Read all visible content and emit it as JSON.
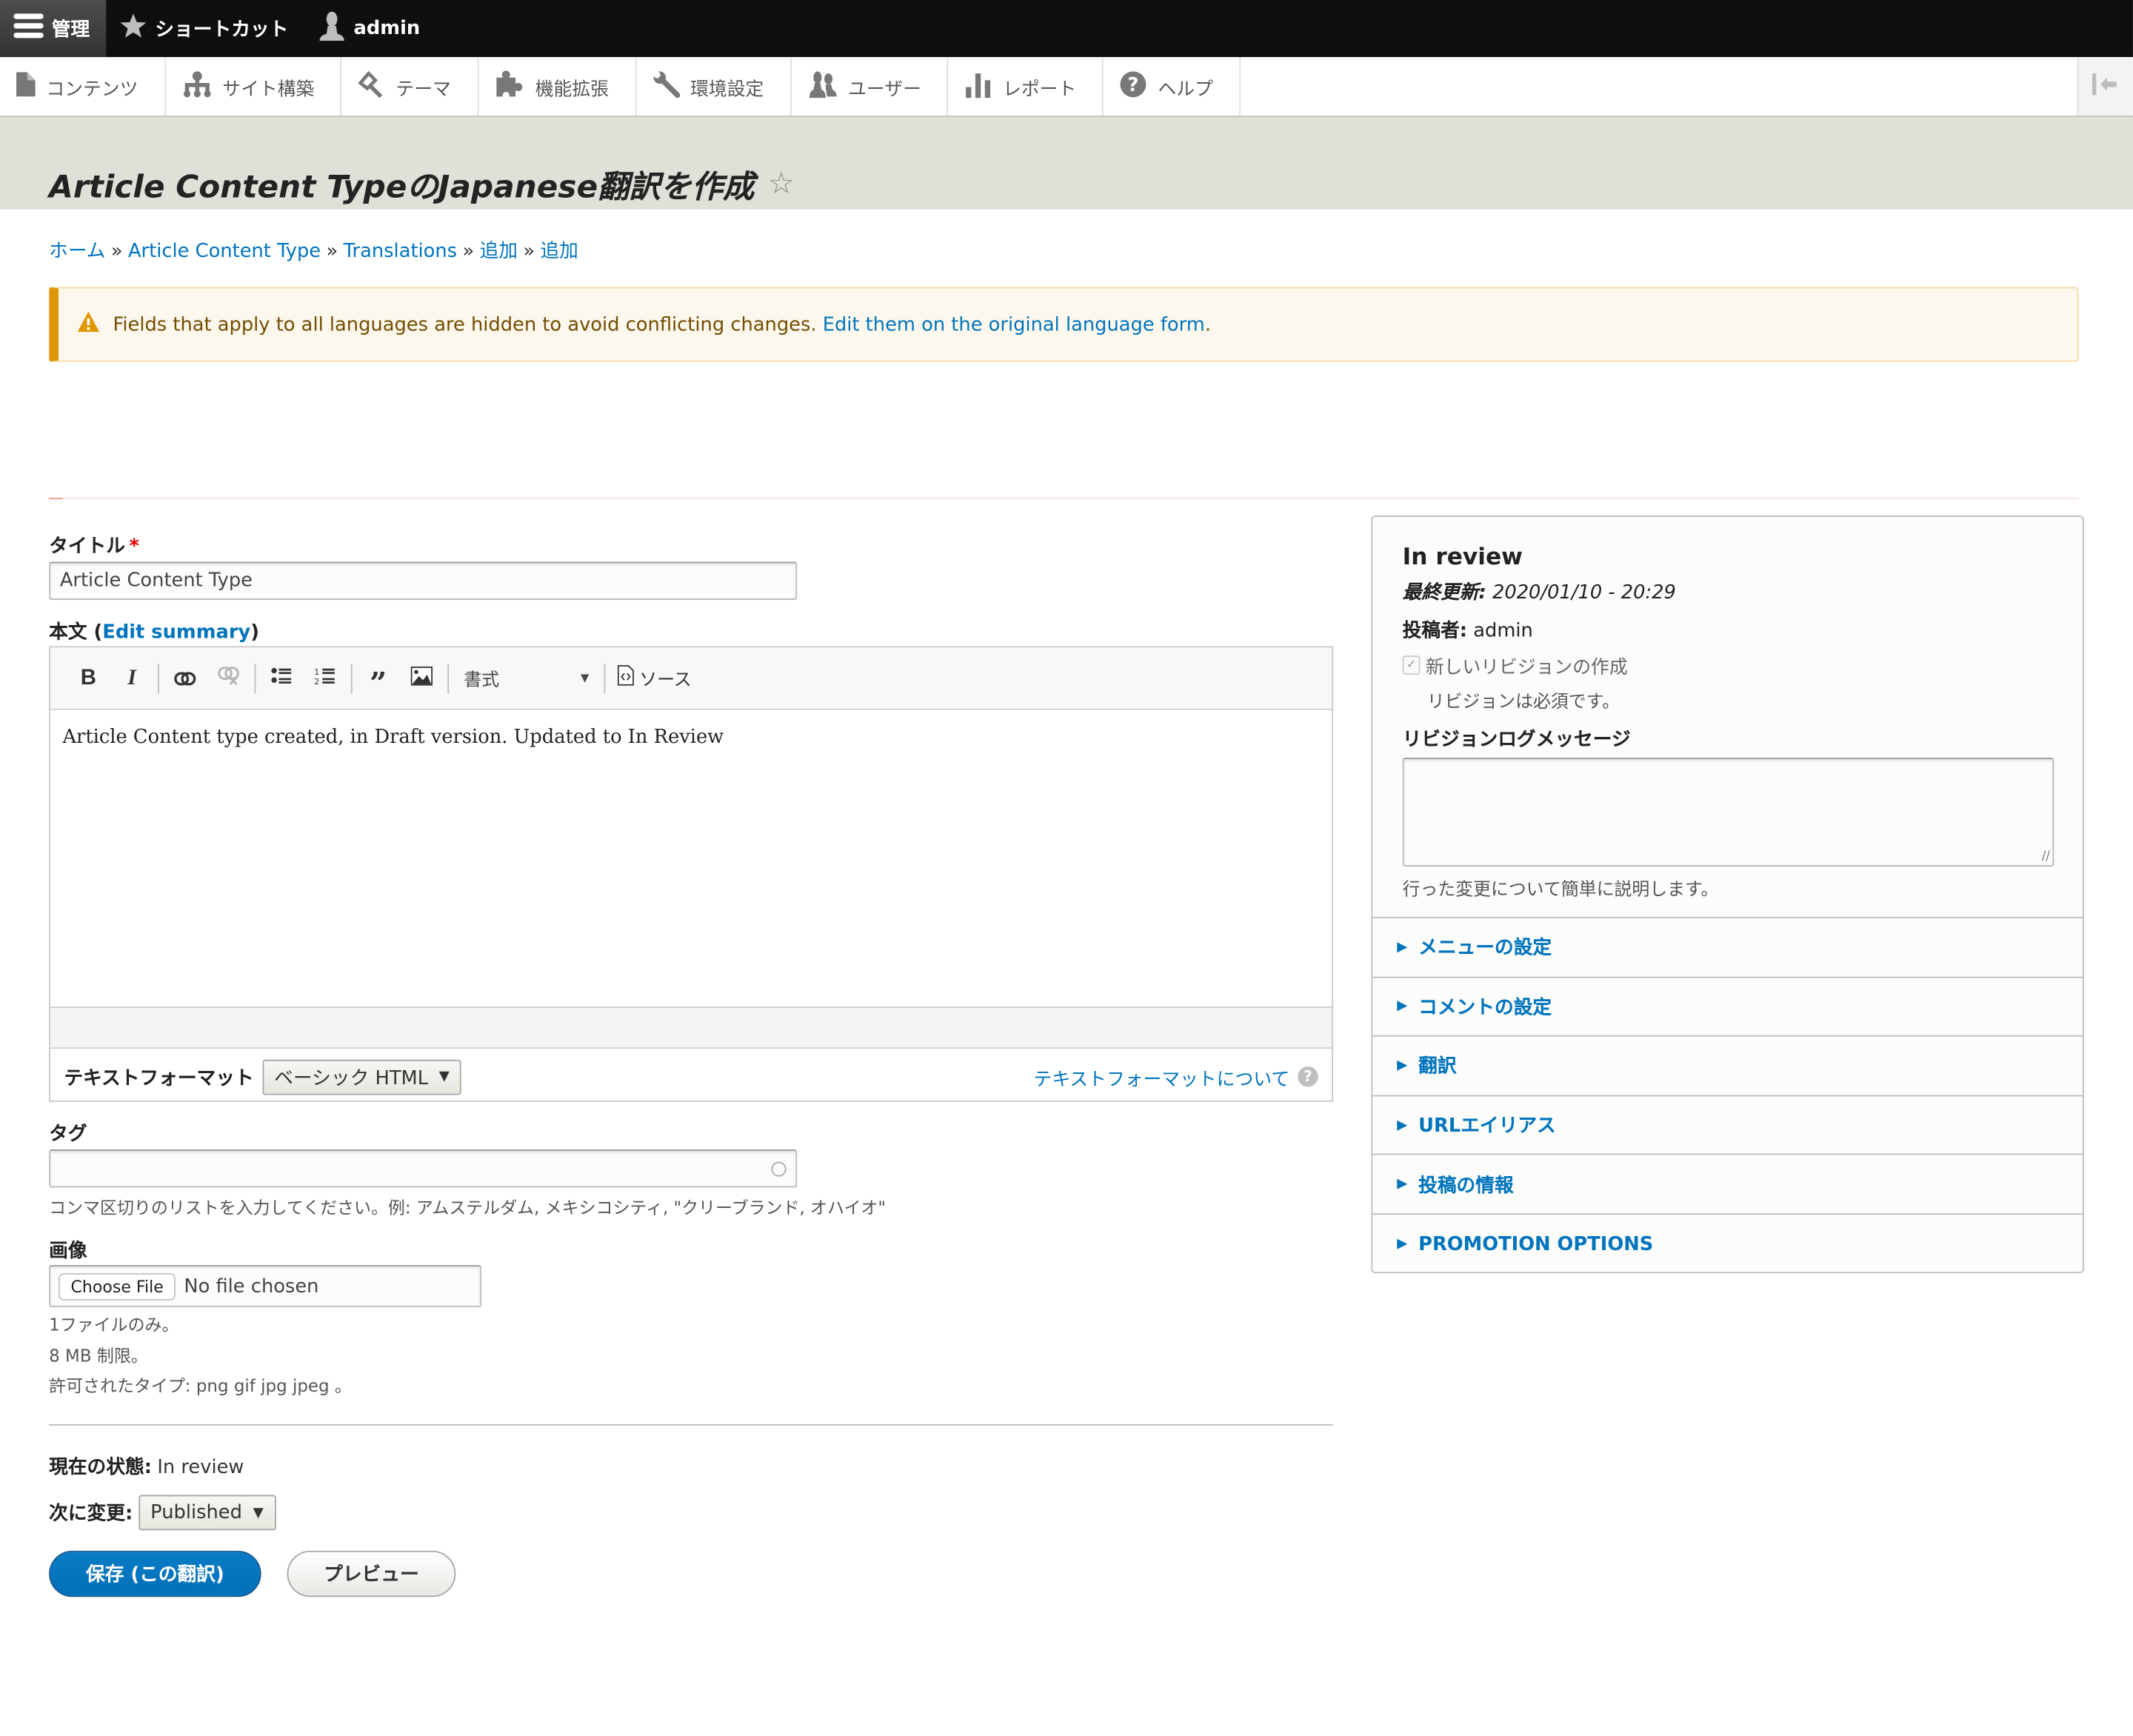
{
  "toolbar": {
    "manage_label": "管理",
    "shortcuts_label": "ショートカット",
    "user_label": "admin"
  },
  "tray": {
    "items": [
      {
        "label": "コンテンツ",
        "icon": "file-icon"
      },
      {
        "label": "サイト構築",
        "icon": "sitemap-icon"
      },
      {
        "label": "テーマ",
        "icon": "paintbrush-icon"
      },
      {
        "label": "機能拡張",
        "icon": "puzzle-icon"
      },
      {
        "label": "環境設定",
        "icon": "wrench-icon"
      },
      {
        "label": "ユーザー",
        "icon": "people-icon"
      },
      {
        "label": "レポート",
        "icon": "bar-chart-icon"
      },
      {
        "label": "ヘルプ",
        "icon": "help-icon"
      }
    ]
  },
  "page": {
    "title": "Article Content TypeのJapanese翻訳を作成"
  },
  "breadcrumb": {
    "items": [
      "ホーム",
      "Article Content Type",
      "Translations",
      "追加",
      "追加"
    ],
    "separator": "»"
  },
  "warning": {
    "text": "Fields that apply to all languages are hidden to avoid conflicting changes.",
    "link": "Edit them on the original language form",
    "suffix": "."
  },
  "form": {
    "title_label": "タイトル",
    "required_mark": "*",
    "title_value": "Article Content Type",
    "body_label": "本文",
    "edit_summary": "Edit summary",
    "editor": {
      "bold": "B",
      "italic": "I",
      "format_label": "書式",
      "source_label": "ソース",
      "content": "Article Content type created, in Draft version. Updated to In Review"
    },
    "text_format_label": "テキストフォーマット",
    "text_format_value": "ベーシック HTML",
    "text_format_help": "テキストフォーマットについて",
    "tags_label": "タグ",
    "tags_value": "",
    "tags_description": "コンマ区切りのリストを入力してください。例: アムステルダム, メキシコシティ, \"クリーブランド, オハイオ\"",
    "image_label": "画像",
    "choose_file": "Choose File",
    "no_file": "No file chosen",
    "image_desc": [
      "1ファイルのみ。",
      "8 MB 制限。",
      "許可されたタイプ: png gif jpg jpeg 。"
    ],
    "current_state_label": "現在の状態:",
    "current_state_value": "In review",
    "change_to_label": "次に変更:",
    "change_to_value": "Published",
    "save_button": "保存 (この翻訳)",
    "preview_button": "プレビュー"
  },
  "sidebar": {
    "status": "In review",
    "last_updated_label": "最終更新:",
    "last_updated_value": "2020/01/10 - 20:29",
    "author_label": "投稿者:",
    "author_value": "admin",
    "new_revision_label": "新しいリビジョンの作成",
    "new_revision_checked": true,
    "new_revision_desc": "リビジョンは必須です。",
    "log_label": "リビジョンログメッセージ",
    "log_value": "",
    "log_desc": "行った変更について簡単に説明します。",
    "sections": [
      "メニューの設定",
      "コメントの設定",
      "翻訳",
      "URLエイリアス",
      "投稿の情報",
      "PROMOTION OPTIONS"
    ]
  },
  "colors": {
    "link": "#0074bd",
    "primary_button": "#0071b8",
    "warning_border": "#e09600",
    "warning_bg": "#fdf8ed",
    "toolbar_bg": "#0f0f0f",
    "header_bg": "#e0e0d8"
  }
}
